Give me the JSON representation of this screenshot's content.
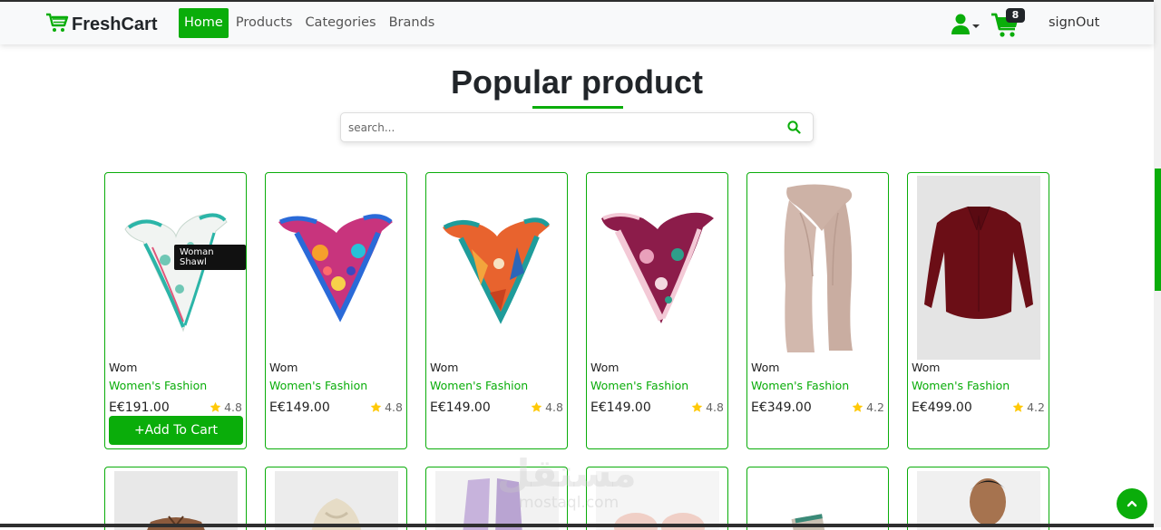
{
  "navbar": {
    "brand": "FreshCart",
    "links": [
      {
        "label": "Home",
        "active": true
      },
      {
        "label": "Products",
        "active": false
      },
      {
        "label": "Categories",
        "active": false
      },
      {
        "label": "Brands",
        "active": false
      }
    ],
    "cart_count": "8",
    "signout_label": "signOut",
    "icons": [
      "cart-icon",
      "user-icon",
      "chevron-down-icon",
      "shopping-cart-icon"
    ],
    "accent_color": "#0aad0a"
  },
  "main": {
    "heading": "Popular product",
    "search_placeholder": "search...",
    "tooltip": "Woman Shawl",
    "add_to_cart_label": "+Add To Cart",
    "watermark": "مستقل",
    "watermark_url": "mostaql.com"
  },
  "products": [
    {
      "category_short": "Wom",
      "category": "Women's Fashion",
      "price": "E€191.00",
      "rating": "4.8",
      "image": "floral white scarf"
    },
    {
      "category_short": "Wom",
      "category": "Women's Fashion",
      "price": "E€149.00",
      "rating": "4.8",
      "image": "pink blue scarf"
    },
    {
      "category_short": "Wom",
      "category": "Women's Fashion",
      "price": "E€149.00",
      "rating": "4.8",
      "image": "orange teal scarf"
    },
    {
      "category_short": "Wom",
      "category": "Women's Fashion",
      "price": "E€149.00",
      "rating": "4.8",
      "image": "burgundy floral scarf"
    },
    {
      "category_short": "Wom",
      "category": "Women's Fashion",
      "price": "E€349.00",
      "rating": "4.2",
      "image": "beige shawl"
    },
    {
      "category_short": "Wom",
      "category": "Women's Fashion",
      "price": "E€499.00",
      "rating": "4.2",
      "image": "burgundy blouse"
    }
  ]
}
